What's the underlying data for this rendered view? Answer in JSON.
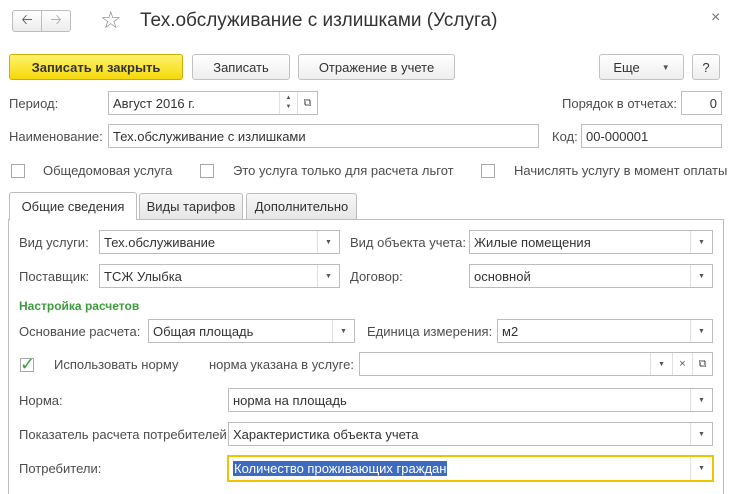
{
  "window": {
    "title": "Тех.обслуживание с излишками (Услуга)",
    "back_icon": "arrow-left-icon",
    "forward_icon": "arrow-right-icon",
    "close_glyph": "×"
  },
  "toolbar": {
    "save_close": "Записать и закрыть",
    "save": "Записать",
    "accounting": "Отражение в учете",
    "more": "Еще",
    "help": "?"
  },
  "header": {
    "period_label": "Период:",
    "period_value": "Август 2016 г.",
    "order_label": "Порядок в отчетах:",
    "order_value": "0",
    "name_label": "Наименование:",
    "name_value": "Тех.обслуживание с излишками",
    "code_label": "Код:",
    "code_value": "00-000001"
  },
  "checkboxes": {
    "common_house": "Общедомовая услуга",
    "benefits_only": "Это услуга только для расчета льгот",
    "charge_on_payment": "Начислять услугу в момент оплаты"
  },
  "tabs": [
    "Общие сведения",
    "Виды тарифов",
    "Дополнительно"
  ],
  "general": {
    "service_type_label": "Вид услуги:",
    "service_type_value": "Тех.обслуживание",
    "object_type_label": "Вид объекта учета:",
    "object_type_value": "Жилые помещения",
    "supplier_label": "Поставщик:",
    "supplier_value": "ТСЖ Улыбка",
    "contract_label": "Договор:",
    "contract_value": "основной",
    "calc_settings_title": "Настройка расчетов",
    "calc_basis_label": "Основание расчета:",
    "calc_basis_value": "Общая  площадь",
    "unit_label": "Единица измерения:",
    "unit_value": "м2",
    "use_norm_label": "Использовать норму",
    "use_norm_checked": true,
    "norm_in_service_label": "норма указана в услуге:",
    "norm_in_service_value": "",
    "norm_label": "Норма:",
    "norm_value": "норма на площадь",
    "consumer_indicator_label": "Показатель расчета потребителей:",
    "consumer_indicator_value": "Характеристика объекта учета",
    "consumers_label": "Потребители:",
    "consumers_value": "Количество проживающих граждан"
  }
}
